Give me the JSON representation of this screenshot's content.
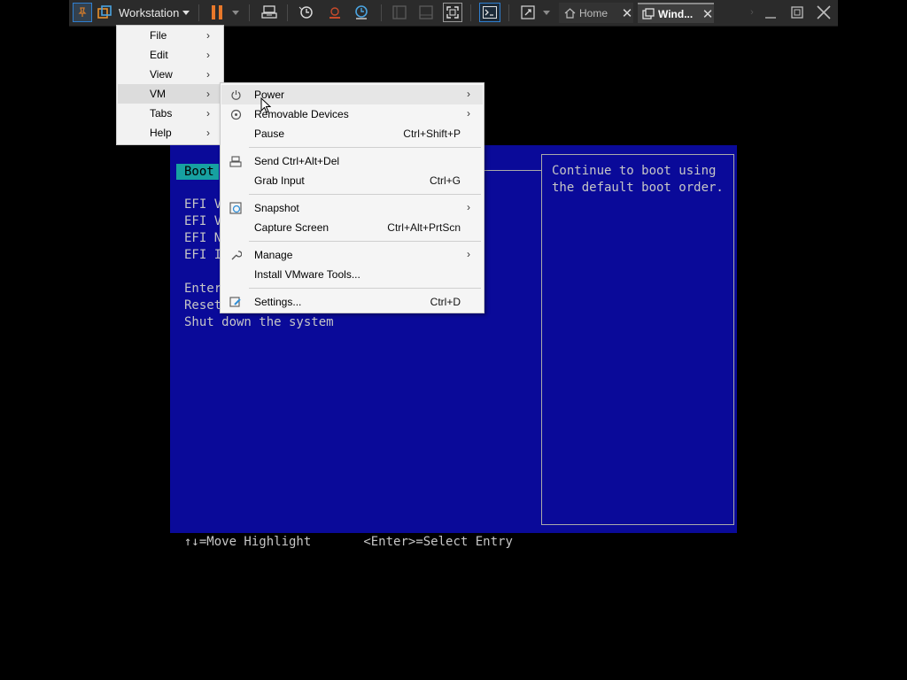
{
  "toolbar": {
    "workstation_label": "Workstation",
    "tabs": [
      {
        "label": "Home"
      },
      {
        "label": "Wind..."
      }
    ]
  },
  "app_menu": {
    "items": [
      {
        "label": "File",
        "arrow": "›"
      },
      {
        "label": "Edit",
        "arrow": "›"
      },
      {
        "label": "View",
        "arrow": "›"
      },
      {
        "label": "VM",
        "arrow": "›"
      },
      {
        "label": "Tabs",
        "arrow": "›"
      },
      {
        "label": "Help",
        "arrow": "›"
      }
    ]
  },
  "vm_menu": {
    "items": [
      {
        "label": "Power",
        "shortcut": "",
        "arrow": "›",
        "icon": "power-icon"
      },
      {
        "label": "Removable Devices",
        "shortcut": "",
        "arrow": "›",
        "icon": "removable-devices-icon"
      },
      {
        "label": "Pause",
        "shortcut": "Ctrl+Shift+P",
        "arrow": "",
        "icon": ""
      },
      {
        "label": "Send Ctrl+Alt+Del",
        "shortcut": "",
        "arrow": "",
        "icon": "send-keys-icon"
      },
      {
        "label": "Grab Input",
        "shortcut": "Ctrl+G",
        "arrow": "",
        "icon": ""
      },
      {
        "label": "Snapshot",
        "shortcut": "",
        "arrow": "›",
        "icon": "snapshot-icon"
      },
      {
        "label": "Capture Screen",
        "shortcut": "Ctrl+Alt+PrtScn",
        "arrow": "",
        "icon": ""
      },
      {
        "label": "Manage",
        "shortcut": "",
        "arrow": "›",
        "icon": "wrench-icon"
      },
      {
        "label": "Install VMware Tools...",
        "shortcut": "",
        "arrow": "",
        "icon": ""
      },
      {
        "label": "Settings...",
        "shortcut": "Ctrl+D",
        "arrow": "",
        "icon": "settings-icon"
      }
    ]
  },
  "bios": {
    "tab_label": "Boot",
    "entries": [
      "EFI V",
      "EFI V",
      "EFI N",
      "EFI I"
    ],
    "actions": [
      "Enter",
      "Reset",
      "Shut down the system"
    ],
    "help_text": "Continue to boot using\nthe default boot order.",
    "footer_move": "↑↓=Move Highlight",
    "footer_select": "<Enter>=Select Entry",
    "colors": {
      "background": "#0a0a99",
      "highlight": "#17a1a1",
      "text": "#c6c6c6"
    }
  }
}
